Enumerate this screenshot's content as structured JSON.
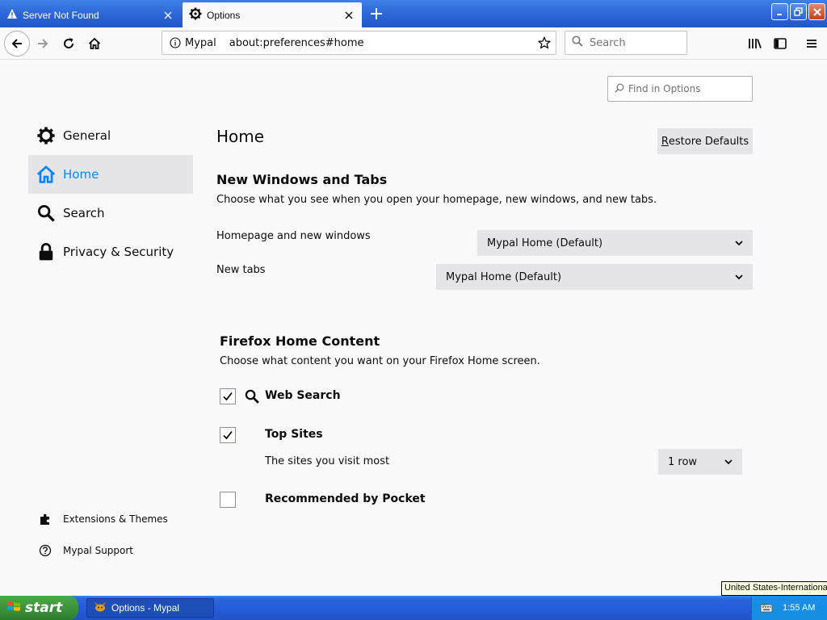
{
  "tabs": [
    {
      "label": "Server Not Found",
      "icon": "warning-icon",
      "active": false
    },
    {
      "label": "Options",
      "icon": "gear-icon",
      "active": true
    }
  ],
  "navbar": {
    "identity_label": "Mypal",
    "url": "about:preferences#home",
    "search_placeholder": "Search"
  },
  "find": {
    "placeholder": "Find in Options"
  },
  "sidebar": {
    "items": [
      {
        "label": "General",
        "icon": "gear-icon"
      },
      {
        "label": "Home",
        "icon": "home-icon",
        "selected": true
      },
      {
        "label": "Search",
        "icon": "search-icon"
      },
      {
        "label": "Privacy & Security",
        "icon": "lock-icon"
      }
    ],
    "footer": [
      {
        "label": "Extensions & Themes",
        "icon": "puzzle-icon"
      },
      {
        "label": "Mypal Support",
        "icon": "help-icon"
      }
    ]
  },
  "main": {
    "title": "Home",
    "restore_label_first": "R",
    "restore_label_rest": "estore Defaults",
    "new_windows": {
      "title": "New Windows and Tabs",
      "description": "Choose what you see when you open your homepage, new windows, and new tabs.",
      "homepage_label": "Homepage and new windows",
      "homepage_value": "Mypal Home (Default)",
      "newtabs_label": "New tabs",
      "newtabs_value": "Mypal Home (Default)"
    },
    "home_content": {
      "title": "Firefox Home Content",
      "description": "Choose what content you want on your Firefox Home screen.",
      "web_search": {
        "label": "Web Search",
        "checked": true
      },
      "top_sites": {
        "label": "Top Sites",
        "checked": true,
        "description": "The sites you visit most",
        "rows_value": "1 row"
      },
      "pocket": {
        "label": "Recommended by Pocket",
        "checked": false
      }
    }
  },
  "taskbar": {
    "start_label": "start",
    "task_label": "Options - Mypal",
    "clock": "1:55 AM",
    "language_tooltip": "United States-International"
  },
  "colors": {
    "accent": "#0a84ff",
    "taskbar": "#245ddb",
    "start": "#3a8f3a"
  }
}
